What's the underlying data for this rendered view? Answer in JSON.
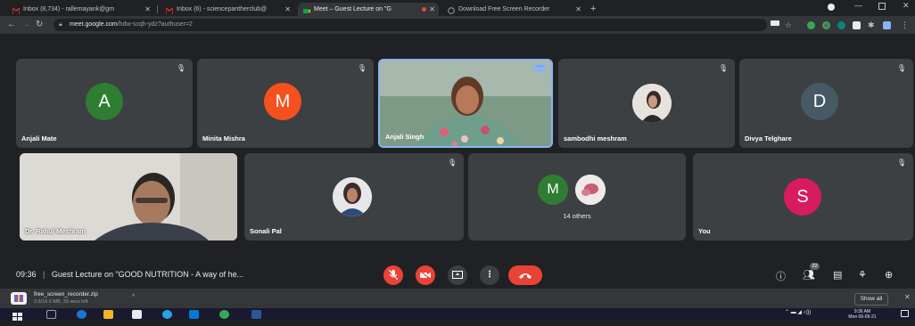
{
  "browser": {
    "tabs": [
      {
        "label": "Inbox (8,734) - rallemayank@gm",
        "favicon_color": "#d93025"
      },
      {
        "label": "Inbox (6) - sciencepantherclub@",
        "favicon_color": "#d93025"
      },
      {
        "label": "Meet – Guest Lecture on \"G",
        "favicon_color": "#00ac47"
      },
      {
        "label": "Download Free Screen Recorder",
        "favicon_color": "#9aa0a6"
      }
    ],
    "url_host": "meet.google.com",
    "url_path": "/hdw-scqh-ydz?authuser=2"
  },
  "participants": [
    {
      "name": "Anjali Mate",
      "initial": "A",
      "color": "#2e7d32"
    },
    {
      "name": "Minita Mishra",
      "initial": "M",
      "color": "#f4511e"
    },
    {
      "name": "Anjali Singh",
      "video": true
    },
    {
      "name": "sambodhi meshram",
      "photo": true
    },
    {
      "name": "Divya Telghare",
      "initial": "D",
      "color": "#455a64"
    },
    {
      "name": "Dr. Rahul Meshram",
      "video": true
    },
    {
      "name": "Sonali Pal",
      "photo": true
    },
    {
      "name": "14 others",
      "initial": "M",
      "color": "#2e7d32"
    },
    {
      "name": "You",
      "initial": "S",
      "color": "#d81b60"
    }
  ],
  "meeting": {
    "time": "09:36",
    "separator": "|",
    "title": "Guest Lecture on \"GOOD NUTRITION - A way of he...",
    "people_count": "22"
  },
  "download": {
    "filename": "free_screen_recorder.zip",
    "progress": "3.6/15.6 MB, 33 secs left",
    "show_all": "Show all"
  },
  "taskbar": {
    "time": "9:36 AM",
    "date": "Mon 06-09-21"
  }
}
